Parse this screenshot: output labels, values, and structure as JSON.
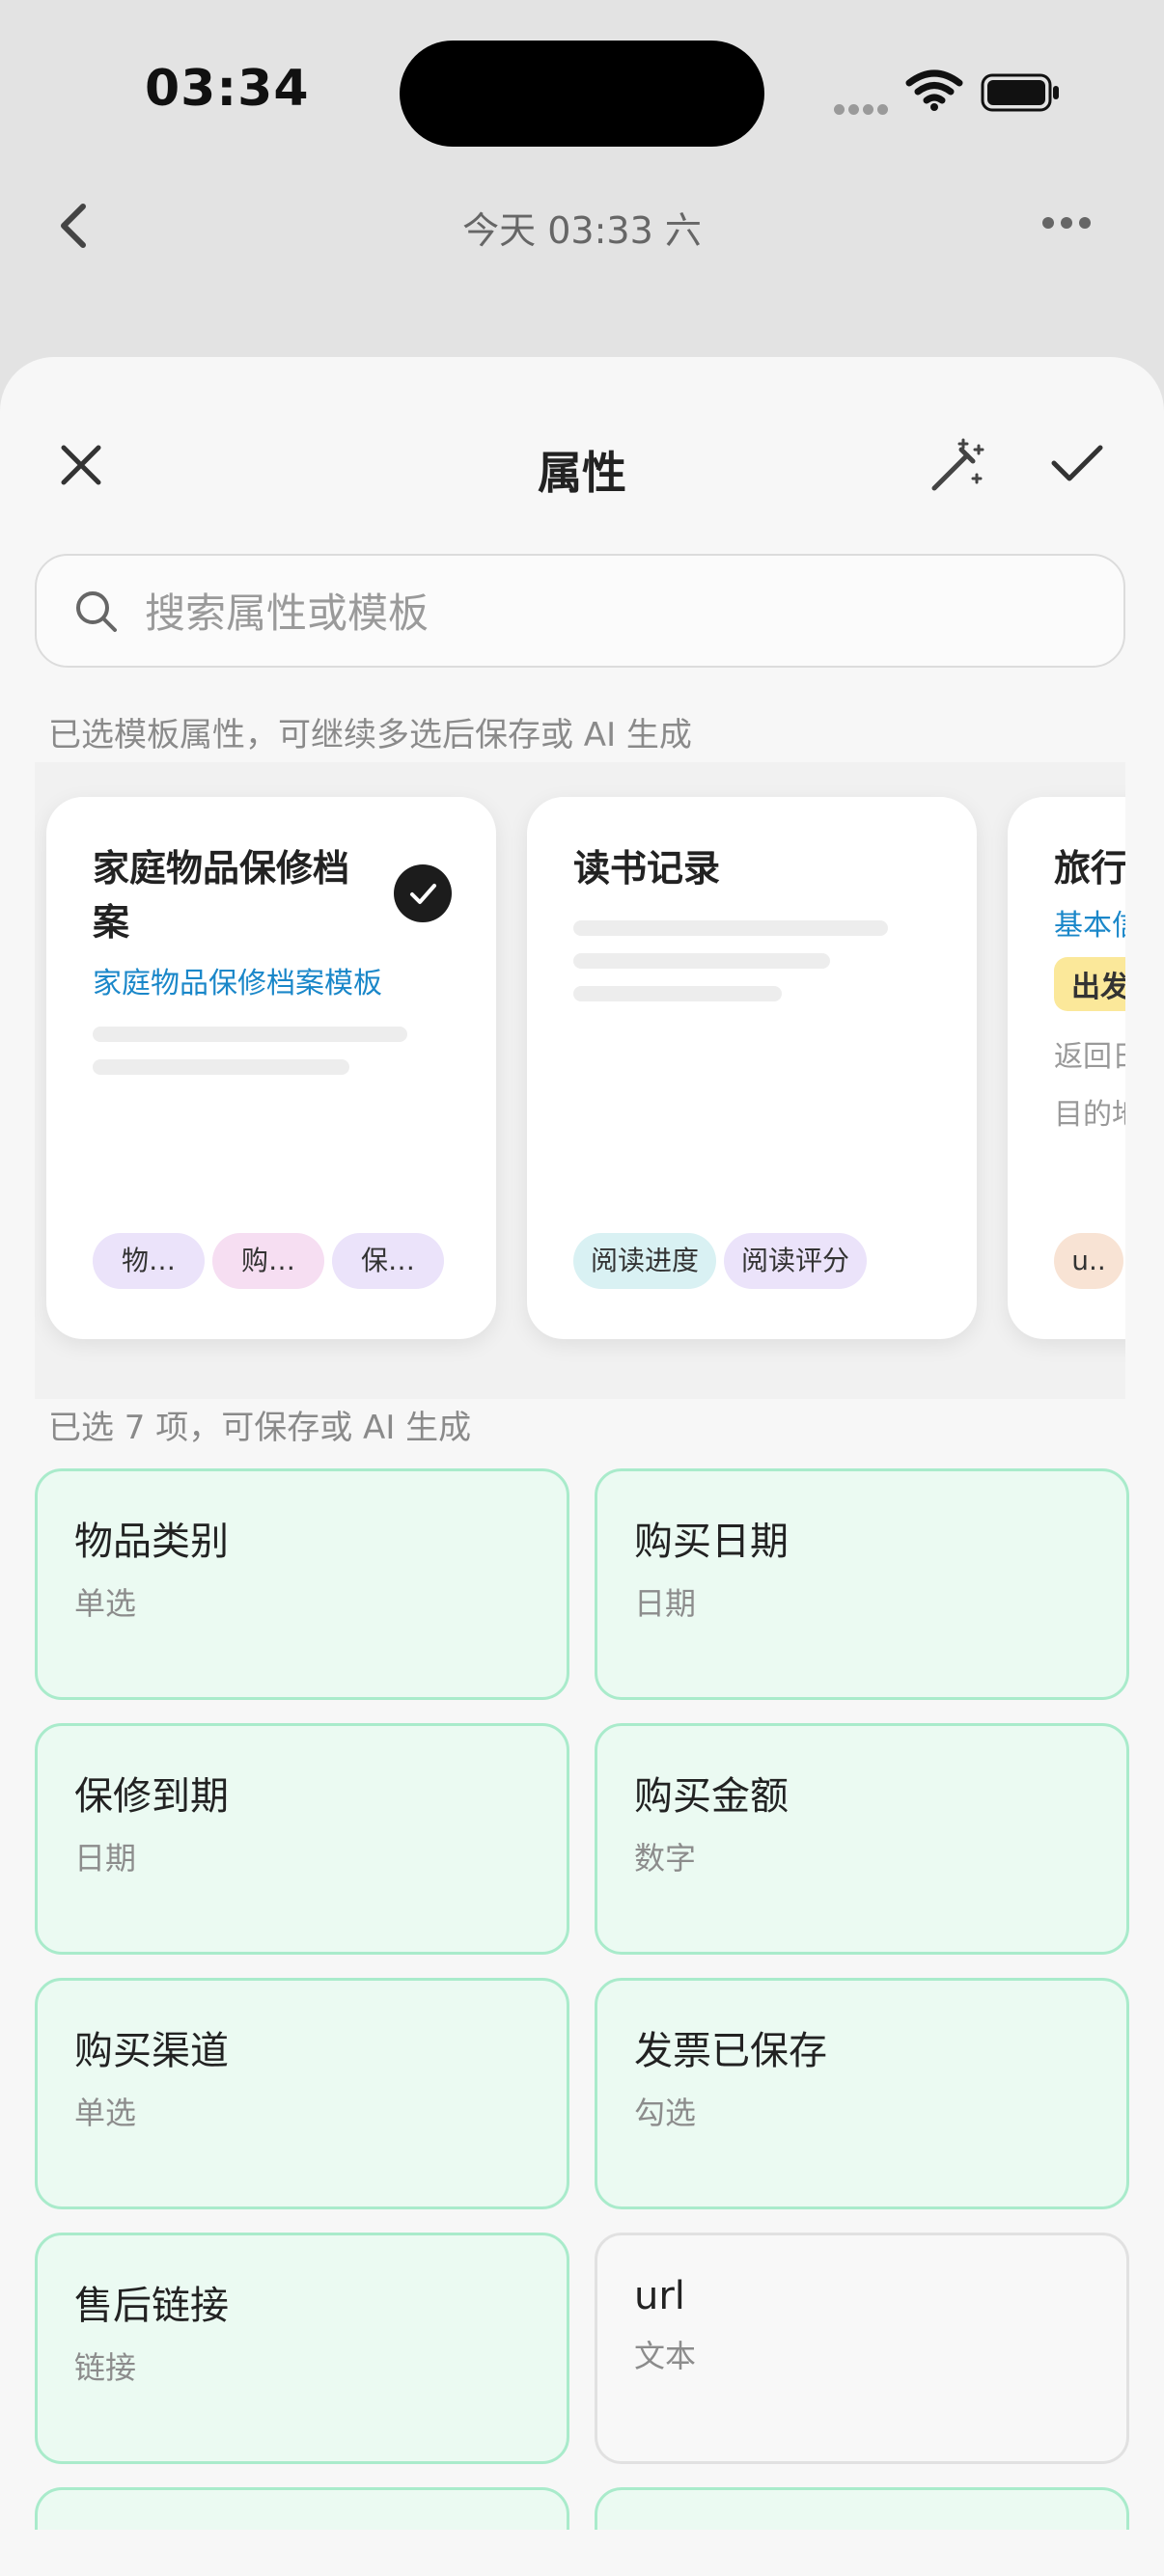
{
  "status": {
    "time": "03:34"
  },
  "nav": {
    "title": "今天 03:33 六"
  },
  "sheet": {
    "title": "属性",
    "search_placeholder": "搜索属性或模板",
    "template_hint": "已选模板属性，可继续多选后保存或 AI 生成",
    "selection_hint": "已选 7 项，可保存或 AI 生成"
  },
  "templates": [
    {
      "title": "家庭物品保修档案",
      "subtitle": "家庭物品保修档案模板",
      "selected": true,
      "chips": [
        {
          "label": "物…",
          "color": "#ebe3fa"
        },
        {
          "label": "购…",
          "color": "#f6def2"
        },
        {
          "label": "保…",
          "color": "#ebe3fa"
        }
      ]
    },
    {
      "title": "读书记录",
      "selected": false,
      "chips": [
        {
          "label": "阅读进度",
          "color": "#d9f1f3"
        },
        {
          "label": "阅读评分",
          "color": "#ebe3fa"
        }
      ]
    },
    {
      "title": "旅行",
      "subtitle": "基本信",
      "tag": "出发",
      "lines": [
        "返回日",
        "目的地"
      ],
      "chips": [
        {
          "label": "u..",
          "color": "#f8e3d4"
        }
      ]
    }
  ],
  "attributes": [
    {
      "name": "物品类别",
      "type": "单选",
      "selected": true
    },
    {
      "name": "购买日期",
      "type": "日期",
      "selected": true
    },
    {
      "name": "保修到期",
      "type": "日期",
      "selected": true
    },
    {
      "name": "购买金额",
      "type": "数字",
      "selected": true
    },
    {
      "name": "购买渠道",
      "type": "单选",
      "selected": true
    },
    {
      "name": "发票已保存",
      "type": "勾选",
      "selected": true
    },
    {
      "name": "售后链接",
      "type": "链接",
      "selected": true
    },
    {
      "name": "url",
      "type": "文本",
      "selected": false
    }
  ],
  "colors": {
    "accent_link": "#1a87c9",
    "selected_bg": "#ebfaf2",
    "selected_border": "#a9ebcb"
  }
}
